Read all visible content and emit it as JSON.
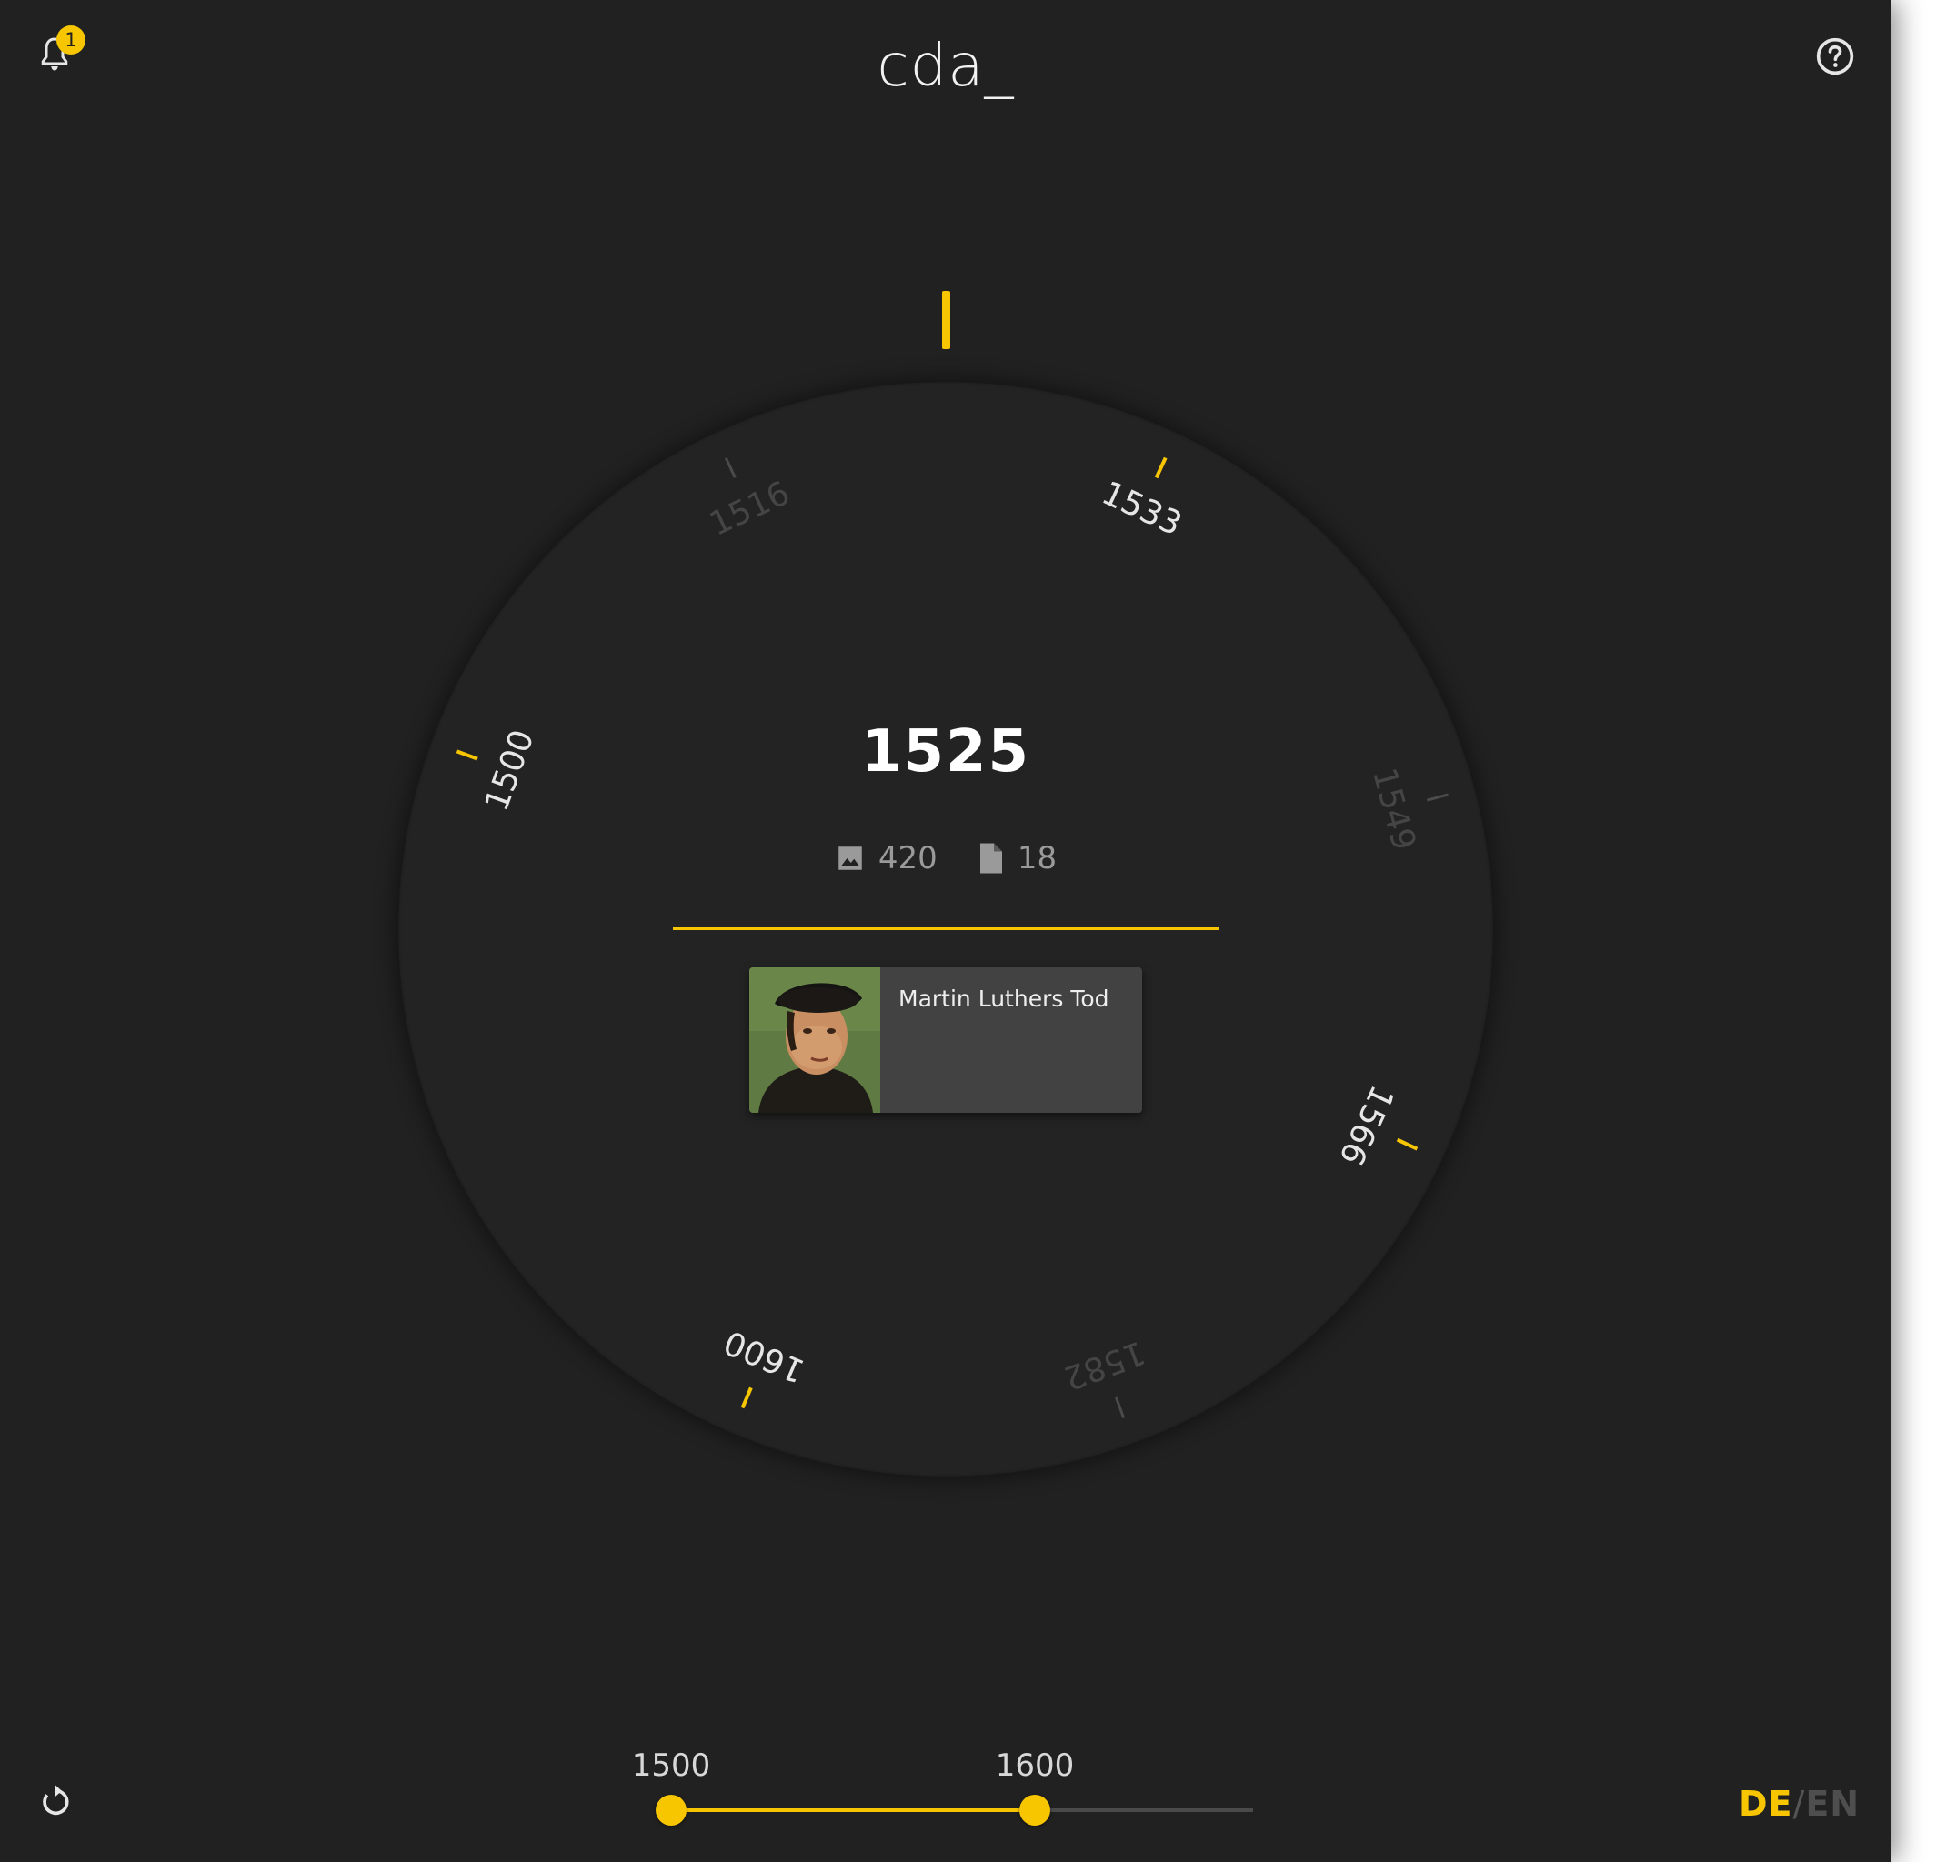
{
  "header": {
    "title": "cda_",
    "notification_count": "1",
    "bell_icon": "bell-icon",
    "help_icon": "help-circle-icon"
  },
  "dial": {
    "current_year": "1525",
    "ticks": [
      {
        "label": "1500",
        "highlighted": true
      },
      {
        "label": "1516",
        "highlighted": false
      },
      {
        "label": "1533",
        "highlighted": true
      },
      {
        "label": "1549",
        "highlighted": false
      },
      {
        "label": "1566",
        "highlighted": true
      },
      {
        "label": "1582",
        "highlighted": false
      },
      {
        "label": "1600",
        "highlighted": true
      }
    ],
    "colors": {
      "accent": "#f7c600",
      "tick_dim": "#4b4b4b",
      "label_highlight": "#e6e6e6",
      "label_dim": "#454545"
    }
  },
  "stats": {
    "images_count": "420",
    "images_icon": "image-icon",
    "documents_count": "18",
    "documents_icon": "document-icon"
  },
  "event_card": {
    "title": "Martin Luthers Tod",
    "image_icon": "portrait-thumbnail"
  },
  "range": {
    "min_label": "1500",
    "max_label": "1600",
    "low_fraction": 0.0,
    "high_fraction": 0.625
  },
  "footer": {
    "reset_icon": "reset-icon",
    "lang_de": "DE",
    "lang_sep": "/",
    "lang_en": "EN"
  }
}
